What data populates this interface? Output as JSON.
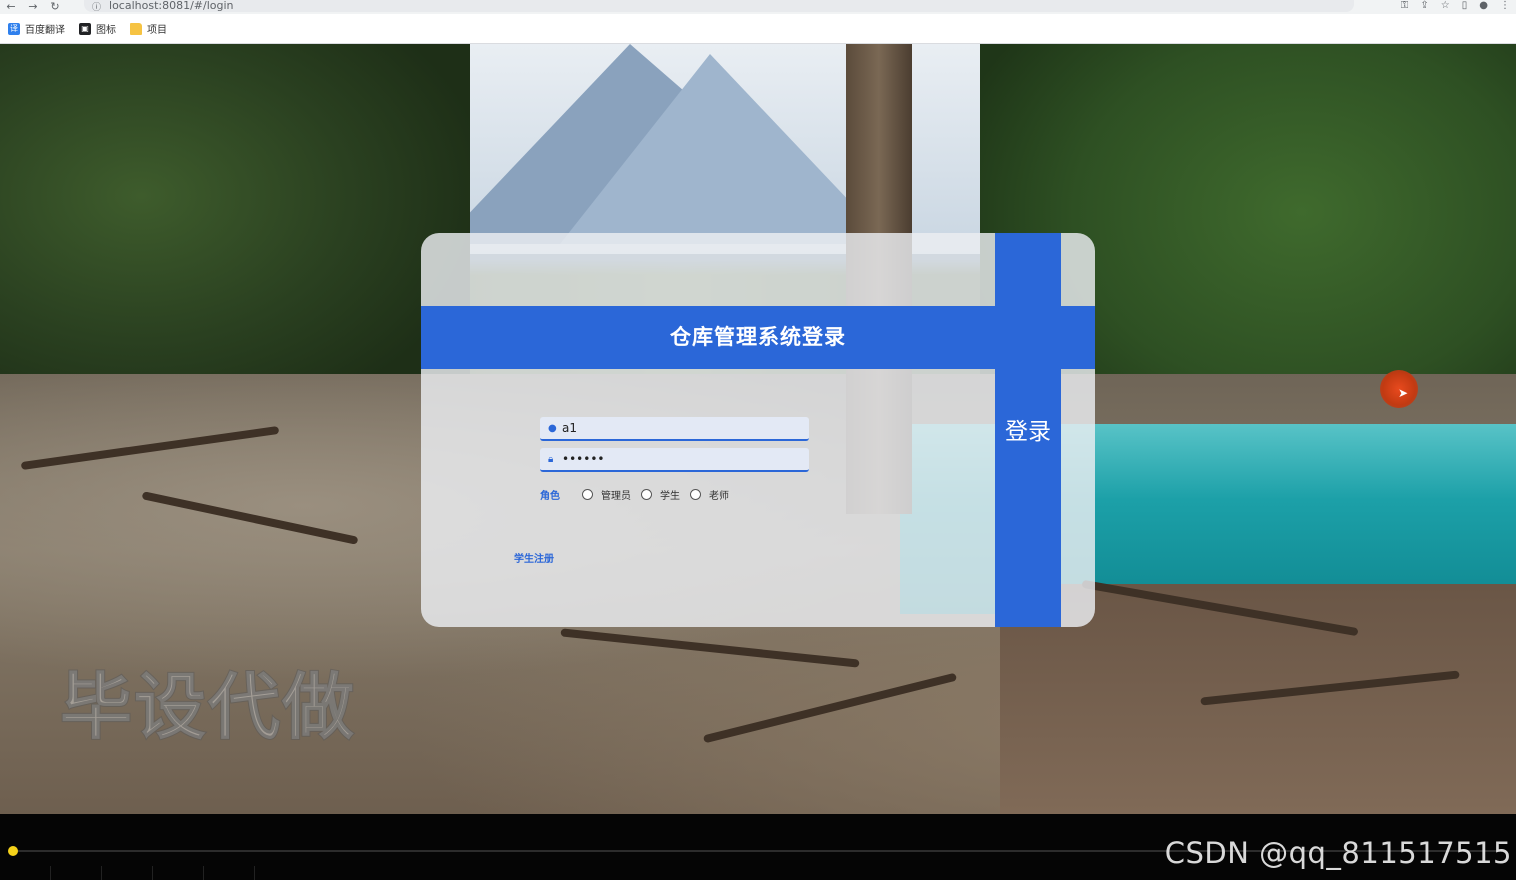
{
  "browser": {
    "url": "localhost:8081/#/login",
    "bookmarks": [
      {
        "label": "百度翻译",
        "icon": "translate-icon"
      },
      {
        "label": "图标",
        "icon": "image-icon"
      },
      {
        "label": "项目",
        "icon": "folder-icon"
      }
    ]
  },
  "login": {
    "title": "仓库管理系统登录",
    "button_label": "登录",
    "username_value": "a1",
    "password_value": "••••••",
    "role_label": "角色",
    "roles": [
      "管理员",
      "学生",
      "老师"
    ],
    "register_link": "学生注册"
  },
  "watermark": {
    "text": "毕设代做",
    "credit": "CSDN @qq_811517515"
  },
  "colors": {
    "accent": "#2b67d8",
    "card_bg": "#eceef2",
    "progress_knob": "#f5d21a"
  }
}
